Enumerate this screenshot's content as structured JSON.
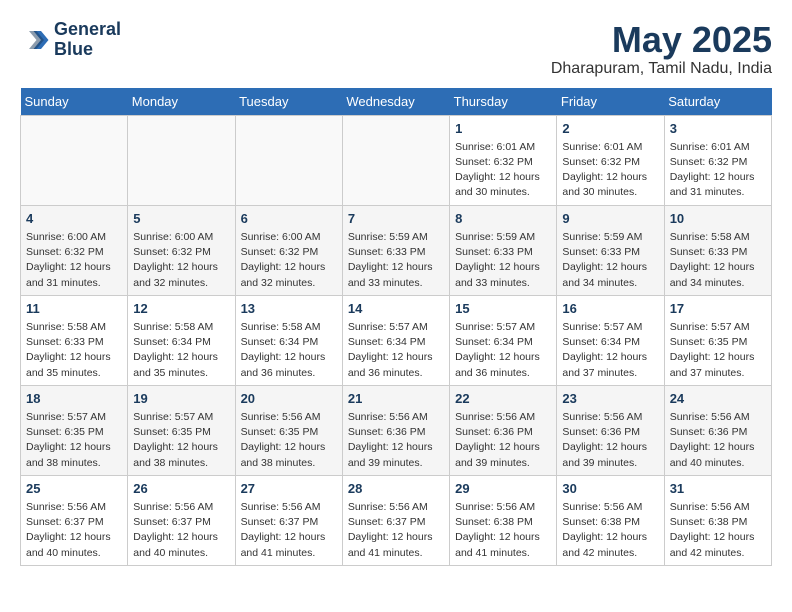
{
  "header": {
    "logo_line1": "General",
    "logo_line2": "Blue",
    "title": "May 2025",
    "subtitle": "Dharapuram, Tamil Nadu, India"
  },
  "calendar": {
    "days_of_week": [
      "Sunday",
      "Monday",
      "Tuesday",
      "Wednesday",
      "Thursday",
      "Friday",
      "Saturday"
    ],
    "weeks": [
      [
        {
          "day": "",
          "info": ""
        },
        {
          "day": "",
          "info": ""
        },
        {
          "day": "",
          "info": ""
        },
        {
          "day": "",
          "info": ""
        },
        {
          "day": "1",
          "info": "Sunrise: 6:01 AM\nSunset: 6:32 PM\nDaylight: 12 hours\nand 30 minutes."
        },
        {
          "day": "2",
          "info": "Sunrise: 6:01 AM\nSunset: 6:32 PM\nDaylight: 12 hours\nand 30 minutes."
        },
        {
          "day": "3",
          "info": "Sunrise: 6:01 AM\nSunset: 6:32 PM\nDaylight: 12 hours\nand 31 minutes."
        }
      ],
      [
        {
          "day": "4",
          "info": "Sunrise: 6:00 AM\nSunset: 6:32 PM\nDaylight: 12 hours\nand 31 minutes."
        },
        {
          "day": "5",
          "info": "Sunrise: 6:00 AM\nSunset: 6:32 PM\nDaylight: 12 hours\nand 32 minutes."
        },
        {
          "day": "6",
          "info": "Sunrise: 6:00 AM\nSunset: 6:32 PM\nDaylight: 12 hours\nand 32 minutes."
        },
        {
          "day": "7",
          "info": "Sunrise: 5:59 AM\nSunset: 6:33 PM\nDaylight: 12 hours\nand 33 minutes."
        },
        {
          "day": "8",
          "info": "Sunrise: 5:59 AM\nSunset: 6:33 PM\nDaylight: 12 hours\nand 33 minutes."
        },
        {
          "day": "9",
          "info": "Sunrise: 5:59 AM\nSunset: 6:33 PM\nDaylight: 12 hours\nand 34 minutes."
        },
        {
          "day": "10",
          "info": "Sunrise: 5:58 AM\nSunset: 6:33 PM\nDaylight: 12 hours\nand 34 minutes."
        }
      ],
      [
        {
          "day": "11",
          "info": "Sunrise: 5:58 AM\nSunset: 6:33 PM\nDaylight: 12 hours\nand 35 minutes."
        },
        {
          "day": "12",
          "info": "Sunrise: 5:58 AM\nSunset: 6:34 PM\nDaylight: 12 hours\nand 35 minutes."
        },
        {
          "day": "13",
          "info": "Sunrise: 5:58 AM\nSunset: 6:34 PM\nDaylight: 12 hours\nand 36 minutes."
        },
        {
          "day": "14",
          "info": "Sunrise: 5:57 AM\nSunset: 6:34 PM\nDaylight: 12 hours\nand 36 minutes."
        },
        {
          "day": "15",
          "info": "Sunrise: 5:57 AM\nSunset: 6:34 PM\nDaylight: 12 hours\nand 36 minutes."
        },
        {
          "day": "16",
          "info": "Sunrise: 5:57 AM\nSunset: 6:34 PM\nDaylight: 12 hours\nand 37 minutes."
        },
        {
          "day": "17",
          "info": "Sunrise: 5:57 AM\nSunset: 6:35 PM\nDaylight: 12 hours\nand 37 minutes."
        }
      ],
      [
        {
          "day": "18",
          "info": "Sunrise: 5:57 AM\nSunset: 6:35 PM\nDaylight: 12 hours\nand 38 minutes."
        },
        {
          "day": "19",
          "info": "Sunrise: 5:57 AM\nSunset: 6:35 PM\nDaylight: 12 hours\nand 38 minutes."
        },
        {
          "day": "20",
          "info": "Sunrise: 5:56 AM\nSunset: 6:35 PM\nDaylight: 12 hours\nand 38 minutes."
        },
        {
          "day": "21",
          "info": "Sunrise: 5:56 AM\nSunset: 6:36 PM\nDaylight: 12 hours\nand 39 minutes."
        },
        {
          "day": "22",
          "info": "Sunrise: 5:56 AM\nSunset: 6:36 PM\nDaylight: 12 hours\nand 39 minutes."
        },
        {
          "day": "23",
          "info": "Sunrise: 5:56 AM\nSunset: 6:36 PM\nDaylight: 12 hours\nand 39 minutes."
        },
        {
          "day": "24",
          "info": "Sunrise: 5:56 AM\nSunset: 6:36 PM\nDaylight: 12 hours\nand 40 minutes."
        }
      ],
      [
        {
          "day": "25",
          "info": "Sunrise: 5:56 AM\nSunset: 6:37 PM\nDaylight: 12 hours\nand 40 minutes."
        },
        {
          "day": "26",
          "info": "Sunrise: 5:56 AM\nSunset: 6:37 PM\nDaylight: 12 hours\nand 40 minutes."
        },
        {
          "day": "27",
          "info": "Sunrise: 5:56 AM\nSunset: 6:37 PM\nDaylight: 12 hours\nand 41 minutes."
        },
        {
          "day": "28",
          "info": "Sunrise: 5:56 AM\nSunset: 6:37 PM\nDaylight: 12 hours\nand 41 minutes."
        },
        {
          "day": "29",
          "info": "Sunrise: 5:56 AM\nSunset: 6:38 PM\nDaylight: 12 hours\nand 41 minutes."
        },
        {
          "day": "30",
          "info": "Sunrise: 5:56 AM\nSunset: 6:38 PM\nDaylight: 12 hours\nand 42 minutes."
        },
        {
          "day": "31",
          "info": "Sunrise: 5:56 AM\nSunset: 6:38 PM\nDaylight: 12 hours\nand 42 minutes."
        }
      ]
    ]
  }
}
